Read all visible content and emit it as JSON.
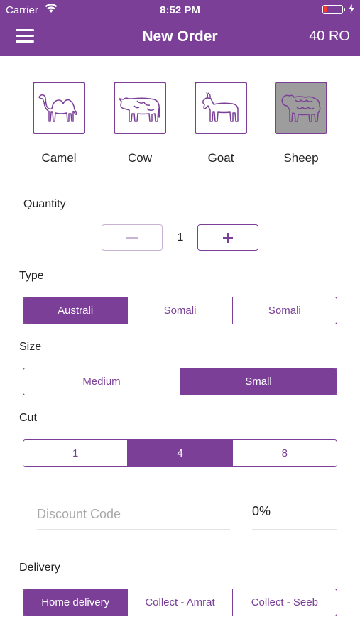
{
  "status_bar": {
    "carrier": "Carrier",
    "time": "8:52 PM",
    "battery_level": 0.15
  },
  "nav": {
    "title": "New Order",
    "total": "40 RO"
  },
  "animals": [
    {
      "label": "Camel",
      "icon": "camel-icon",
      "selected": false
    },
    {
      "label": "Cow",
      "icon": "cow-icon",
      "selected": false
    },
    {
      "label": "Goat",
      "icon": "goat-icon",
      "selected": false
    },
    {
      "label": "Sheep",
      "icon": "sheep-icon",
      "selected": true
    }
  ],
  "quantity": {
    "label": "Quantity",
    "value": "1",
    "decrement": "−",
    "increment": "+"
  },
  "type": {
    "label": "Type",
    "options": [
      "Australi",
      "Somali",
      "Somali"
    ],
    "selected_index": 0
  },
  "size": {
    "label": "Size",
    "options": [
      "Medium",
      "Small"
    ],
    "selected_index": 1
  },
  "cut": {
    "label": "Cut",
    "options": [
      "1",
      "4",
      "8"
    ],
    "selected_index": 1
  },
  "discount": {
    "placeholder": "Discount Code",
    "percent": "0%"
  },
  "delivery": {
    "label": "Delivery",
    "options": [
      "Home delivery",
      "Collect - Amrat",
      "Collect - Seeb"
    ],
    "selected_index": 0
  },
  "colors": {
    "accent": "#7b3f98",
    "selected_tile": "#9d9d9d",
    "battery_low": "#ff3b30"
  }
}
